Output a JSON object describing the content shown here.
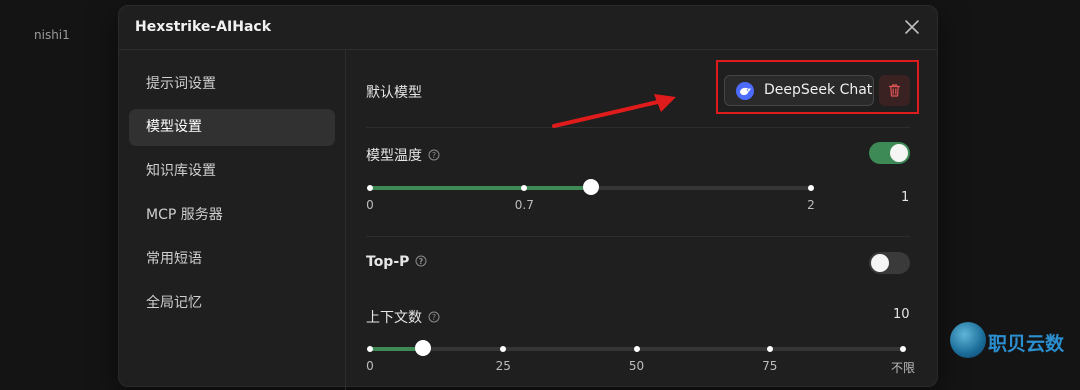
{
  "background": {
    "user_label": "nishi1"
  },
  "dialog": {
    "title": "Hexstrike-AIHack"
  },
  "sidebar": {
    "items": [
      {
        "label": "提示词设置"
      },
      {
        "label": "模型设置",
        "active": true
      },
      {
        "label": "知识库设置"
      },
      {
        "label": "MCP 服务器"
      },
      {
        "label": "常用短语"
      },
      {
        "label": "全局记忆"
      }
    ]
  },
  "settings": {
    "default_model": {
      "label": "默认模型",
      "model_name": "DeepSeek Chat"
    },
    "temperature": {
      "label": "模型温度",
      "enabled": true,
      "value": 1,
      "value_text": "1",
      "min": 0,
      "max": 2,
      "tick_labels": [
        "0",
        "0.7",
        "2"
      ],
      "tick_values": [
        0,
        0.7,
        2
      ]
    },
    "top_p": {
      "label": "Top-P",
      "enabled": false
    },
    "context_count": {
      "label": "上下文数",
      "value": 10,
      "value_text": "10",
      "min": 0,
      "max": 100,
      "tick_labels": [
        "0",
        "25",
        "50",
        "75",
        "不限"
      ],
      "tick_values": [
        0,
        25,
        50,
        75,
        100
      ]
    }
  },
  "colors": {
    "accent": "#3d8a57",
    "annotation": "#e01b1b",
    "delete": "#e05555",
    "deepseek": "#4d6bfe"
  },
  "watermark": {
    "text": "职贝云数"
  }
}
